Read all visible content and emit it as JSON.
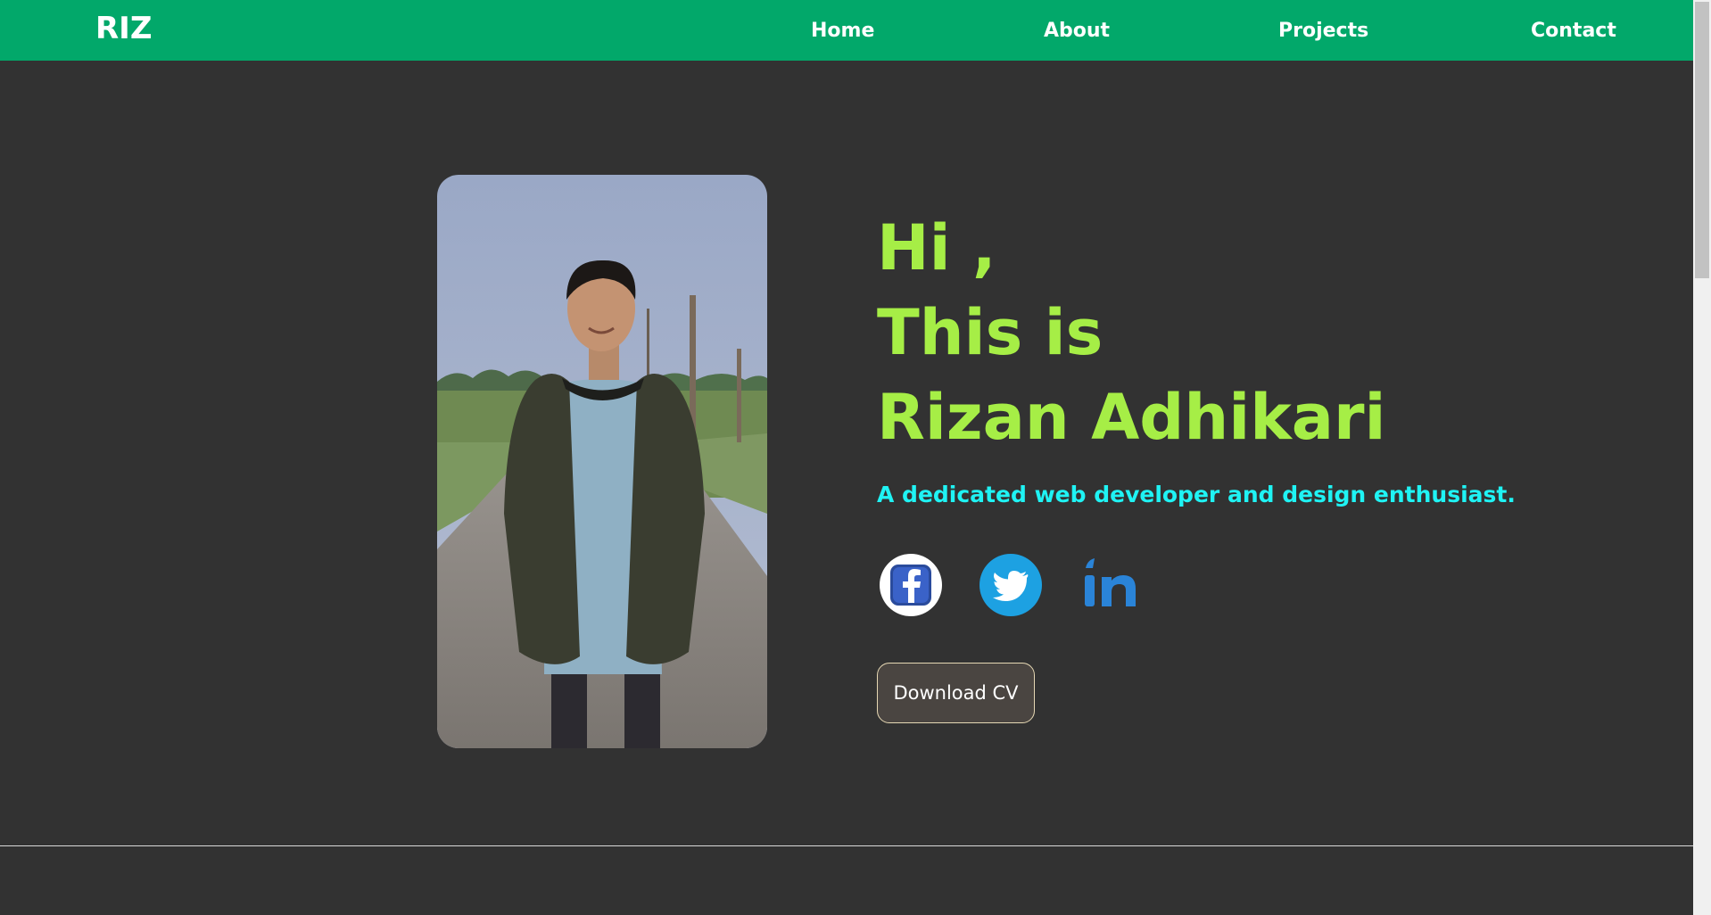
{
  "nav": {
    "logo": "RIZ",
    "links": [
      "Home",
      "About",
      "Projects",
      "Contact"
    ],
    "background": "#02a86a"
  },
  "hero": {
    "greeting": [
      "Hi ,",
      "This is",
      "Rizan Adhikari"
    ],
    "tagline": "A dedicated web developer and design enthusiast.",
    "greeting_color": "#a6ee46",
    "tagline_color": "#1ff3f4",
    "socials": [
      {
        "icon": "facebook-icon"
      },
      {
        "icon": "twitter-icon"
      },
      {
        "icon": "linkedin-icon"
      }
    ],
    "cv_button": "Download CV"
  },
  "colors": {
    "page_background": "#323232",
    "button_background": "#4a4541",
    "button_border": "#e6d8b4"
  }
}
